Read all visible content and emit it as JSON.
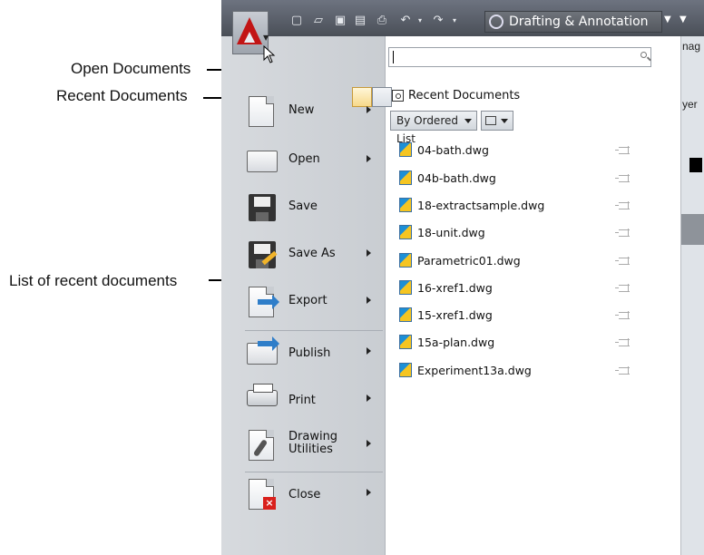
{
  "callouts": {
    "open_documents": "Open Documents",
    "recent_documents": "Recent Documents",
    "list_recent": "List of recent documents"
  },
  "toolbar": {
    "workspace": "Drafting & Annotation",
    "ribbon_tab_fragment": "nag",
    "ribbon_layer_fragment": "yer"
  },
  "menu": {
    "items": [
      {
        "label": "New",
        "icon": "new-document-icon"
      },
      {
        "label": "Open",
        "icon": "open-folder-icon"
      },
      {
        "label": "Save",
        "icon": "save-floppy-icon"
      },
      {
        "label": "Save As",
        "icon": "save-as-icon"
      },
      {
        "label": "Export",
        "icon": "export-icon"
      },
      {
        "label": "Publish",
        "icon": "publish-icon"
      },
      {
        "label": "Print",
        "icon": "printer-icon"
      },
      {
        "label": "Drawing\nUtilities",
        "icon": "wrench-icon"
      },
      {
        "label": "Close",
        "icon": "close-document-icon"
      }
    ]
  },
  "recent": {
    "header": "Recent Documents",
    "sort": "By Ordered List",
    "files": [
      "04-bath.dwg",
      "04b-bath.dwg",
      "18-extractsample.dwg",
      "18-unit.dwg",
      "Parametric01.dwg",
      "16-xref1.dwg",
      "15-xref1.dwg",
      "15a-plan.dwg",
      "Experiment13a.dwg"
    ]
  }
}
